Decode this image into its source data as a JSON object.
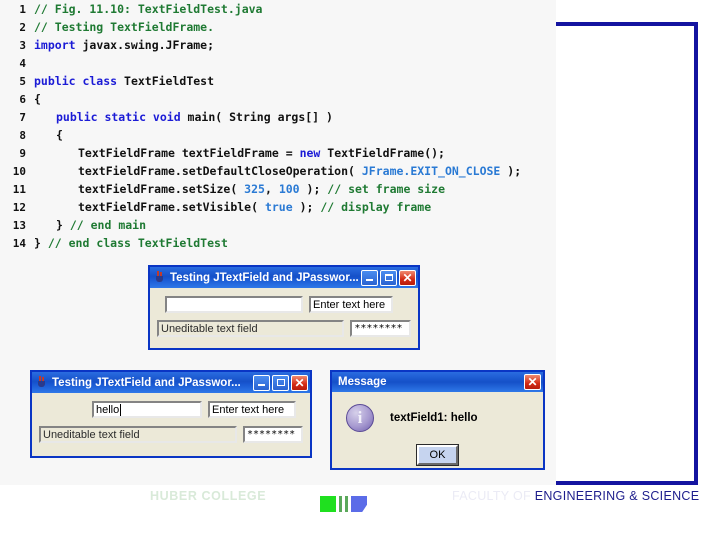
{
  "slide": {
    "accent_blue": "#1414a0",
    "code_bg": "#f7f7f7"
  },
  "code": {
    "lines": [
      {
        "n": "1",
        "indent": 0,
        "tokens": [
          {
            "t": "// Fig. 11.10: TextFieldTest.java",
            "c": "cm"
          }
        ]
      },
      {
        "n": "2",
        "indent": 0,
        "tokens": [
          {
            "t": "// Testing TextFieldFrame.",
            "c": "cm"
          }
        ]
      },
      {
        "n": "3",
        "indent": 0,
        "tokens": [
          {
            "t": "import",
            "c": "kw"
          },
          {
            "t": " javax.swing.JFrame;",
            "c": "id"
          }
        ]
      },
      {
        "n": "4",
        "indent": 0,
        "tokens": []
      },
      {
        "n": "5",
        "indent": 0,
        "tokens": [
          {
            "t": "public class",
            "c": "kw"
          },
          {
            "t": " TextFieldTest",
            "c": "id"
          }
        ]
      },
      {
        "n": "6",
        "indent": 0,
        "tokens": [
          {
            "t": "{",
            "c": "pl"
          }
        ]
      },
      {
        "n": "7",
        "indent": 1,
        "tokens": [
          {
            "t": "public static void",
            "c": "kw"
          },
          {
            "t": " main( ",
            "c": "id"
          },
          {
            "t": "String",
            "c": "id"
          },
          {
            "t": " args[] )",
            "c": "id"
          }
        ]
      },
      {
        "n": "8",
        "indent": 1,
        "tokens": [
          {
            "t": "{",
            "c": "pl"
          }
        ]
      },
      {
        "n": "9",
        "indent": 2,
        "tokens": [
          {
            "t": "TextFieldFrame textFieldFrame = ",
            "c": "id"
          },
          {
            "t": "new",
            "c": "kw"
          },
          {
            "t": " TextFieldFrame();",
            "c": "id"
          }
        ]
      },
      {
        "n": "10",
        "indent": 2,
        "tokens": [
          {
            "t": "textFieldFrame.setDefaultCloseOperation( ",
            "c": "id"
          },
          {
            "t": "JFrame.EXIT_ON_CLOSE",
            "c": "lt"
          },
          {
            "t": " );",
            "c": "id"
          }
        ]
      },
      {
        "n": "11",
        "indent": 2,
        "tokens": [
          {
            "t": "textFieldFrame.setSize( ",
            "c": "id"
          },
          {
            "t": "325",
            "c": "lt"
          },
          {
            "t": ", ",
            "c": "id"
          },
          {
            "t": "100",
            "c": "lt"
          },
          {
            "t": " ); ",
            "c": "id"
          },
          {
            "t": "// set frame size",
            "c": "cm"
          }
        ]
      },
      {
        "n": "12",
        "indent": 2,
        "tokens": [
          {
            "t": "textFieldFrame.setVisible( ",
            "c": "id"
          },
          {
            "t": "true",
            "c": "lt"
          },
          {
            "t": " ); ",
            "c": "id"
          },
          {
            "t": "// display frame",
            "c": "cm"
          }
        ]
      },
      {
        "n": "13",
        "indent": 1,
        "tokens": [
          {
            "t": "} ",
            "c": "pl"
          },
          {
            "t": "// end main",
            "c": "cm"
          }
        ]
      },
      {
        "n": "14",
        "indent": 0,
        "tokens": [
          {
            "t": "} ",
            "c": "pl"
          },
          {
            "t": "// end class TextFieldTest",
            "c": "cm"
          }
        ]
      }
    ]
  },
  "window1": {
    "title": "Testing JTextField and JPasswor...",
    "icon": "java-cup-icon",
    "minimize_label": "Minimize",
    "maximize_label": "Maximize",
    "close_label": "Close",
    "textfield1_value": "",
    "textfield2_value": "Enter text here",
    "textfield3_value": "Uneditable text field",
    "passwordfield_value": "********"
  },
  "window2": {
    "title": "Testing JTextField and JPasswor...",
    "icon": "java-cup-icon",
    "minimize_label": "Minimize",
    "restore_label": "Restore",
    "close_label": "Close",
    "textfield1_value": "hello",
    "textfield2_value": "Enter text here",
    "textfield3_value": "Uneditable text field",
    "passwordfield_value": "********"
  },
  "message_dialog": {
    "title": "Message",
    "close_label": "Close",
    "icon": "information-icon",
    "text": "textField1: hello",
    "ok_label": "OK"
  },
  "footer": {
    "left": "HUBER COLLEGE",
    "right_faded": "FACULTY OF ",
    "right_visible": "ENGINEERING & SCIENCE"
  }
}
